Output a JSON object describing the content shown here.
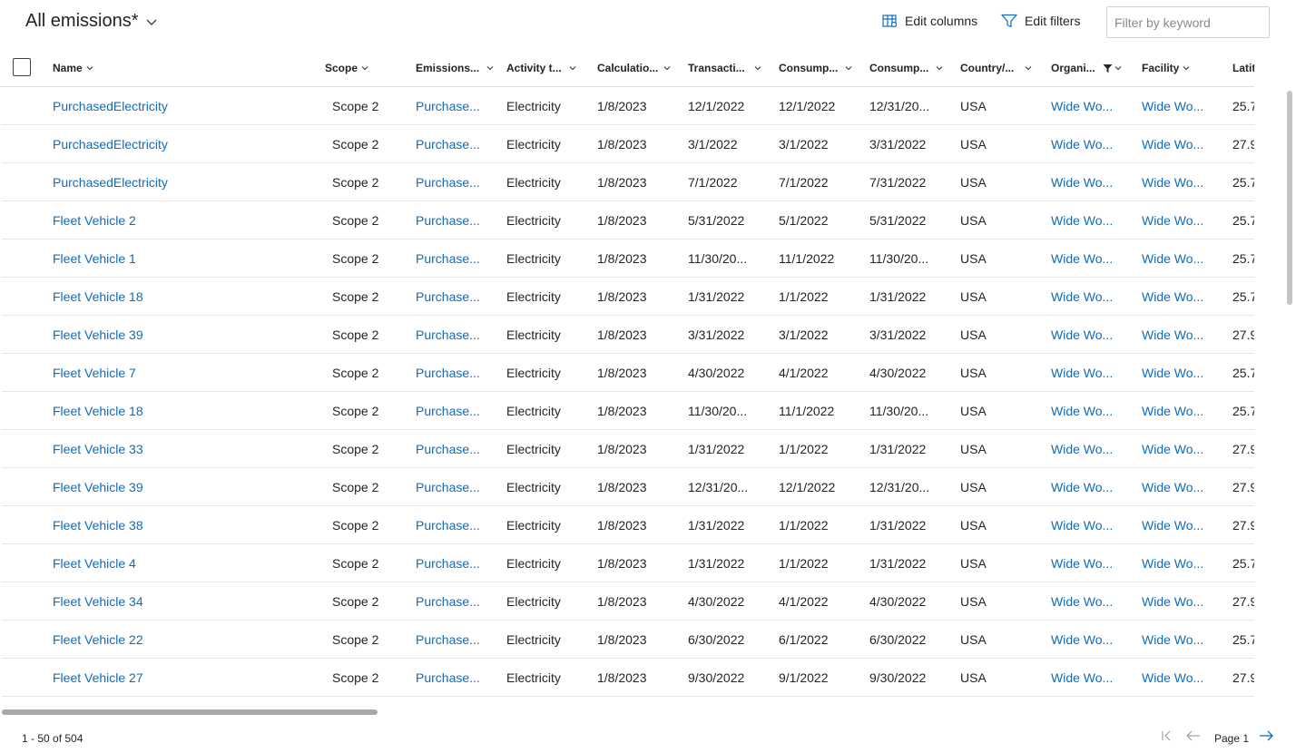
{
  "view": {
    "title": "All emissions*"
  },
  "commands": {
    "edit_columns": "Edit columns",
    "edit_filters": "Edit filters"
  },
  "search": {
    "placeholder": "Filter by keyword"
  },
  "columns": [
    {
      "key": "name",
      "label": "Name"
    },
    {
      "key": "scope",
      "label": "Scope"
    },
    {
      "key": "emissions",
      "label": "Emissions..."
    },
    {
      "key": "activity",
      "label": "Activity t..."
    },
    {
      "key": "calculation",
      "label": "Calculatio..."
    },
    {
      "key": "transaction",
      "label": "Transacti..."
    },
    {
      "key": "consump_start",
      "label": "Consump..."
    },
    {
      "key": "consump_end",
      "label": "Consump..."
    },
    {
      "key": "country",
      "label": "Country/..."
    },
    {
      "key": "organization",
      "label": "Organi..."
    },
    {
      "key": "facility",
      "label": "Facility"
    },
    {
      "key": "latitude",
      "label": "Latitude"
    }
  ],
  "rows": [
    {
      "name": "PurchasedElectricity",
      "scope": "Scope 2",
      "emissions": "Purchase...",
      "activity": "Electricity",
      "calculation": "1/8/2023",
      "transaction": "12/1/2022",
      "consump_start": "12/1/2022",
      "consump_end": "12/31/20...",
      "country": "USA",
      "organization": "Wide Wo...",
      "facility": "Wide Wo...",
      "latitude": "25.7"
    },
    {
      "name": "PurchasedElectricity",
      "scope": "Scope 2",
      "emissions": "Purchase...",
      "activity": "Electricity",
      "calculation": "1/8/2023",
      "transaction": "3/1/2022",
      "consump_start": "3/1/2022",
      "consump_end": "3/31/2022",
      "country": "USA",
      "organization": "Wide Wo...",
      "facility": "Wide Wo...",
      "latitude": "27.9"
    },
    {
      "name": "PurchasedElectricity",
      "scope": "Scope 2",
      "emissions": "Purchase...",
      "activity": "Electricity",
      "calculation": "1/8/2023",
      "transaction": "7/1/2022",
      "consump_start": "7/1/2022",
      "consump_end": "7/31/2022",
      "country": "USA",
      "organization": "Wide Wo...",
      "facility": "Wide Wo...",
      "latitude": "25.7"
    },
    {
      "name": "Fleet Vehicle 2",
      "scope": "Scope 2",
      "emissions": "Purchase...",
      "activity": "Electricity",
      "calculation": "1/8/2023",
      "transaction": "5/31/2022",
      "consump_start": "5/1/2022",
      "consump_end": "5/31/2022",
      "country": "USA",
      "organization": "Wide Wo...",
      "facility": "Wide Wo...",
      "latitude": "25.7"
    },
    {
      "name": "Fleet Vehicle 1",
      "scope": "Scope 2",
      "emissions": "Purchase...",
      "activity": "Electricity",
      "calculation": "1/8/2023",
      "transaction": "11/30/20...",
      "consump_start": "11/1/2022",
      "consump_end": "11/30/20...",
      "country": "USA",
      "organization": "Wide Wo...",
      "facility": "Wide Wo...",
      "latitude": "25.7"
    },
    {
      "name": "Fleet Vehicle 18",
      "scope": "Scope 2",
      "emissions": "Purchase...",
      "activity": "Electricity",
      "calculation": "1/8/2023",
      "transaction": "1/31/2022",
      "consump_start": "1/1/2022",
      "consump_end": "1/31/2022",
      "country": "USA",
      "organization": "Wide Wo...",
      "facility": "Wide Wo...",
      "latitude": "25.7"
    },
    {
      "name": "Fleet Vehicle 39",
      "scope": "Scope 2",
      "emissions": "Purchase...",
      "activity": "Electricity",
      "calculation": "1/8/2023",
      "transaction": "3/31/2022",
      "consump_start": "3/1/2022",
      "consump_end": "3/31/2022",
      "country": "USA",
      "organization": "Wide Wo...",
      "facility": "Wide Wo...",
      "latitude": "27.9"
    },
    {
      "name": "Fleet Vehicle 7",
      "scope": "Scope 2",
      "emissions": "Purchase...",
      "activity": "Electricity",
      "calculation": "1/8/2023",
      "transaction": "4/30/2022",
      "consump_start": "4/1/2022",
      "consump_end": "4/30/2022",
      "country": "USA",
      "organization": "Wide Wo...",
      "facility": "Wide Wo...",
      "latitude": "25.7"
    },
    {
      "name": "Fleet Vehicle 18",
      "scope": "Scope 2",
      "emissions": "Purchase...",
      "activity": "Electricity",
      "calculation": "1/8/2023",
      "transaction": "11/30/20...",
      "consump_start": "11/1/2022",
      "consump_end": "11/30/20...",
      "country": "USA",
      "organization": "Wide Wo...",
      "facility": "Wide Wo...",
      "latitude": "25.7"
    },
    {
      "name": "Fleet Vehicle 33",
      "scope": "Scope 2",
      "emissions": "Purchase...",
      "activity": "Electricity",
      "calculation": "1/8/2023",
      "transaction": "1/31/2022",
      "consump_start": "1/1/2022",
      "consump_end": "1/31/2022",
      "country": "USA",
      "organization": "Wide Wo...",
      "facility": "Wide Wo...",
      "latitude": "27.9"
    },
    {
      "name": "Fleet Vehicle 39",
      "scope": "Scope 2",
      "emissions": "Purchase...",
      "activity": "Electricity",
      "calculation": "1/8/2023",
      "transaction": "12/31/20...",
      "consump_start": "12/1/2022",
      "consump_end": "12/31/20...",
      "country": "USA",
      "organization": "Wide Wo...",
      "facility": "Wide Wo...",
      "latitude": "27.9"
    },
    {
      "name": "Fleet Vehicle 38",
      "scope": "Scope 2",
      "emissions": "Purchase...",
      "activity": "Electricity",
      "calculation": "1/8/2023",
      "transaction": "1/31/2022",
      "consump_start": "1/1/2022",
      "consump_end": "1/31/2022",
      "country": "USA",
      "organization": "Wide Wo...",
      "facility": "Wide Wo...",
      "latitude": "27.9"
    },
    {
      "name": "Fleet Vehicle 4",
      "scope": "Scope 2",
      "emissions": "Purchase...",
      "activity": "Electricity",
      "calculation": "1/8/2023",
      "transaction": "1/31/2022",
      "consump_start": "1/1/2022",
      "consump_end": "1/31/2022",
      "country": "USA",
      "organization": "Wide Wo...",
      "facility": "Wide Wo...",
      "latitude": "25.7"
    },
    {
      "name": "Fleet Vehicle 34",
      "scope": "Scope 2",
      "emissions": "Purchase...",
      "activity": "Electricity",
      "calculation": "1/8/2023",
      "transaction": "4/30/2022",
      "consump_start": "4/1/2022",
      "consump_end": "4/30/2022",
      "country": "USA",
      "organization": "Wide Wo...",
      "facility": "Wide Wo...",
      "latitude": "27.9"
    },
    {
      "name": "Fleet Vehicle 22",
      "scope": "Scope 2",
      "emissions": "Purchase...",
      "activity": "Electricity",
      "calculation": "1/8/2023",
      "transaction": "6/30/2022",
      "consump_start": "6/1/2022",
      "consump_end": "6/30/2022",
      "country": "USA",
      "organization": "Wide Wo...",
      "facility": "Wide Wo...",
      "latitude": "25.7"
    },
    {
      "name": "Fleet Vehicle 27",
      "scope": "Scope 2",
      "emissions": "Purchase...",
      "activity": "Electricity",
      "calculation": "1/8/2023",
      "transaction": "9/30/2022",
      "consump_start": "9/1/2022",
      "consump_end": "9/30/2022",
      "country": "USA",
      "organization": "Wide Wo...",
      "facility": "Wide Wo...",
      "latitude": "27.9"
    }
  ],
  "footer": {
    "record_count": "1 - 50 of 504",
    "page_label": "Page 1"
  },
  "colors": {
    "link": "#0f6cbd",
    "text": "#242424",
    "border": "#e0e0e0"
  },
  "icons": {
    "title_menu": "chevron-down-icon",
    "edit_columns": "edit-columns-icon",
    "edit_filters": "filter-icon",
    "active_filter": "filter-filled-icon",
    "first_page": "first-page-icon",
    "prev_page": "arrow-left-icon",
    "next_page": "arrow-right-icon"
  }
}
